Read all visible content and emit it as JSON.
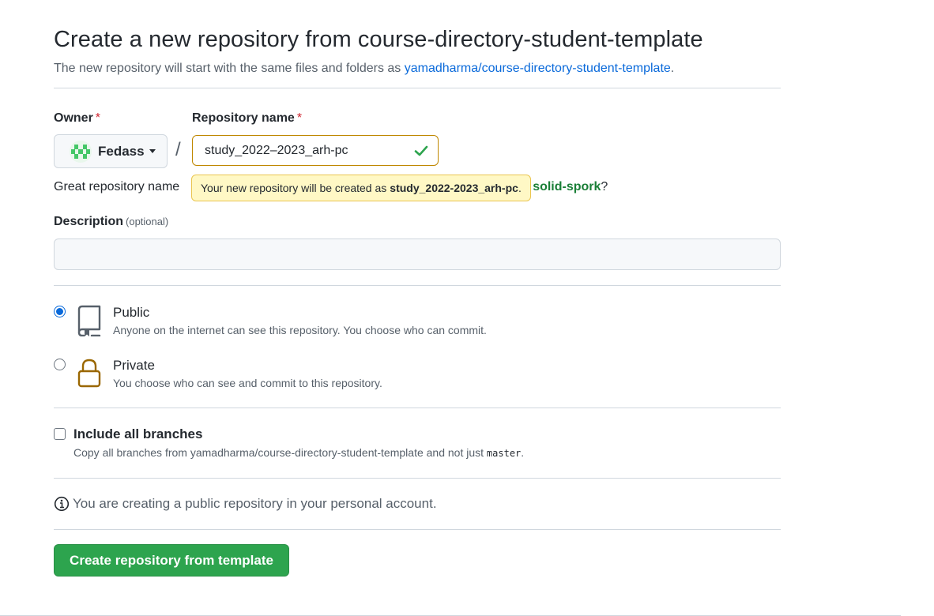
{
  "header": {
    "title": "Create a new repository from course-directory-student-template",
    "subtitle_prefix": "The new repository will start with the same files and folders as ",
    "template_link": "yamadharma/course-directory-student-template",
    "subtitle_suffix": "."
  },
  "owner": {
    "label": "Owner",
    "required_mark": "*",
    "value": "Fedass"
  },
  "separator": "/",
  "repo_name": {
    "label": "Repository name",
    "required_mark": "*",
    "value": "study_2022–2023_arh-pc",
    "status": "valid"
  },
  "suggestion": {
    "prefix": "Great repository name",
    "suggested_name": "solid-spork",
    "suffix": "?"
  },
  "tooltip": {
    "prefix": "Your new repository will be created as",
    "name": "study_2022-2023_arh-pc",
    "suffix": "."
  },
  "description": {
    "label": "Description",
    "optional": "(optional)",
    "value": ""
  },
  "visibility": {
    "selected": "public",
    "options": [
      {
        "title": "Public",
        "note": "Anyone on the internet can see this repository. You choose who can commit.",
        "icon": "repo-icon"
      },
      {
        "title": "Private",
        "note": "You choose who can see and commit to this repository.",
        "icon": "lock-icon"
      }
    ]
  },
  "branches": {
    "label": "Include all branches",
    "checked": false,
    "note_prefix": "Copy all branches from yamadharma/course-directory-student-template and not just ",
    "branch": "master",
    "note_suffix": "."
  },
  "info": {
    "icon": "info-icon",
    "text": "You are creating a public repository in your personal account."
  },
  "submit": {
    "label": "Create repository from template"
  },
  "colors": {
    "accent_blue": "#0969da",
    "success_green": "#2da44e",
    "suggest_green": "#1a7f37",
    "required_red": "#cf222e",
    "tooltip_bg": "#fff8c5",
    "lock_gold": "#9a6700"
  }
}
